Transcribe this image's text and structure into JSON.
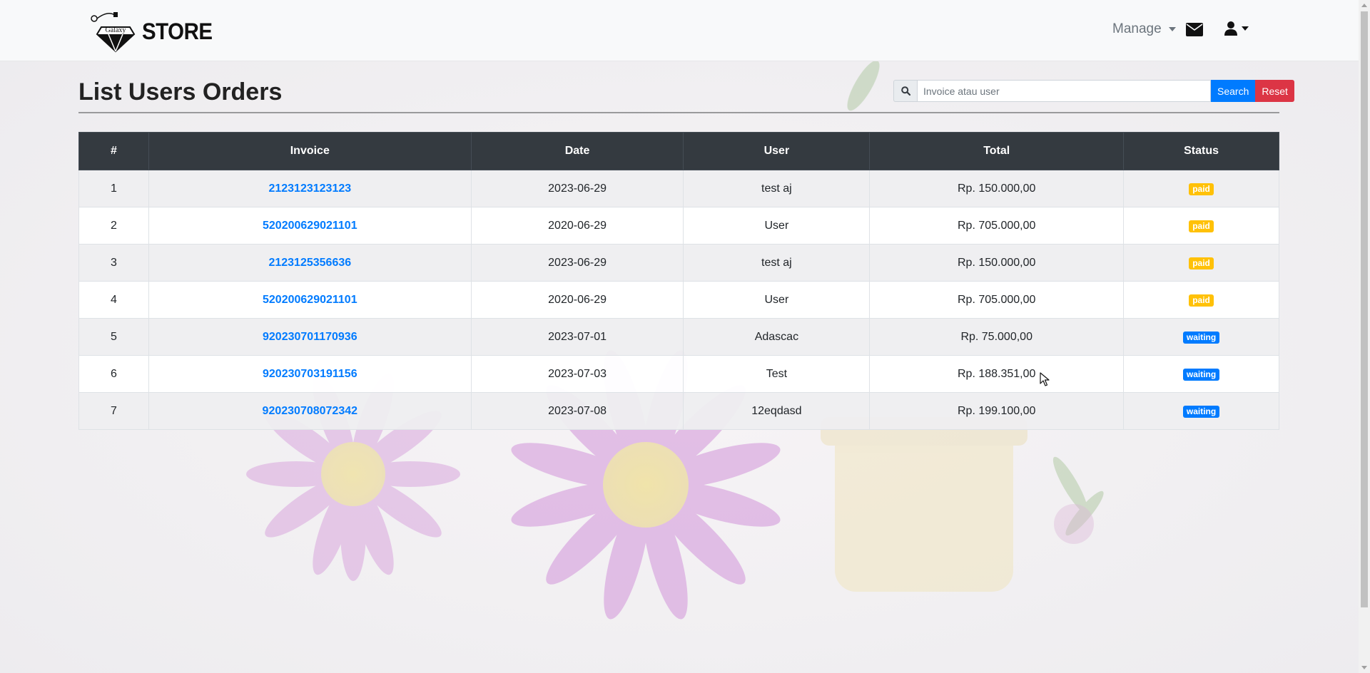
{
  "brand": {
    "logo_text": "STORE",
    "logo_caption": "Galaxy"
  },
  "nav": {
    "manage_label": "Manage"
  },
  "page": {
    "title": "List Users Orders"
  },
  "search": {
    "placeholder": "Invoice atau user",
    "value": "",
    "search_label": "Search",
    "reset_label": "Reset"
  },
  "table": {
    "headers": [
      "#",
      "Invoice",
      "Date",
      "User",
      "Total",
      "Status"
    ],
    "rows": [
      {
        "no": "1",
        "invoice": "2123123123123",
        "date": "2023-06-29",
        "user": "test aj",
        "total": "Rp. 150.000,00",
        "status": "paid"
      },
      {
        "no": "2",
        "invoice": "520200629021101",
        "date": "2020-06-29",
        "user": "User",
        "total": "Rp. 705.000,00",
        "status": "paid"
      },
      {
        "no": "3",
        "invoice": "2123125356636",
        "date": "2023-06-29",
        "user": "test aj",
        "total": "Rp. 150.000,00",
        "status": "paid"
      },
      {
        "no": "4",
        "invoice": "520200629021101",
        "date": "2020-06-29",
        "user": "User",
        "total": "Rp. 705.000,00",
        "status": "paid"
      },
      {
        "no": "5",
        "invoice": "920230701170936",
        "date": "2023-07-01",
        "user": "Adascac",
        "total": "Rp. 75.000,00",
        "status": "waiting"
      },
      {
        "no": "6",
        "invoice": "920230703191156",
        "date": "2023-07-03",
        "user": "Test",
        "total": "Rp. 188.351,00",
        "status": "waiting"
      },
      {
        "no": "7",
        "invoice": "920230708072342",
        "date": "2023-07-08",
        "user": "12eqdasd",
        "total": "Rp. 199.100,00",
        "status": "waiting"
      }
    ]
  },
  "icons": {
    "search": "search-icon",
    "mail": "envelope-icon",
    "user": "user-icon",
    "caret": "caret-down-icon"
  },
  "colors": {
    "primary": "#007bff",
    "danger": "#dc3545",
    "warning": "#ffc107",
    "table_header": "#343a40"
  }
}
